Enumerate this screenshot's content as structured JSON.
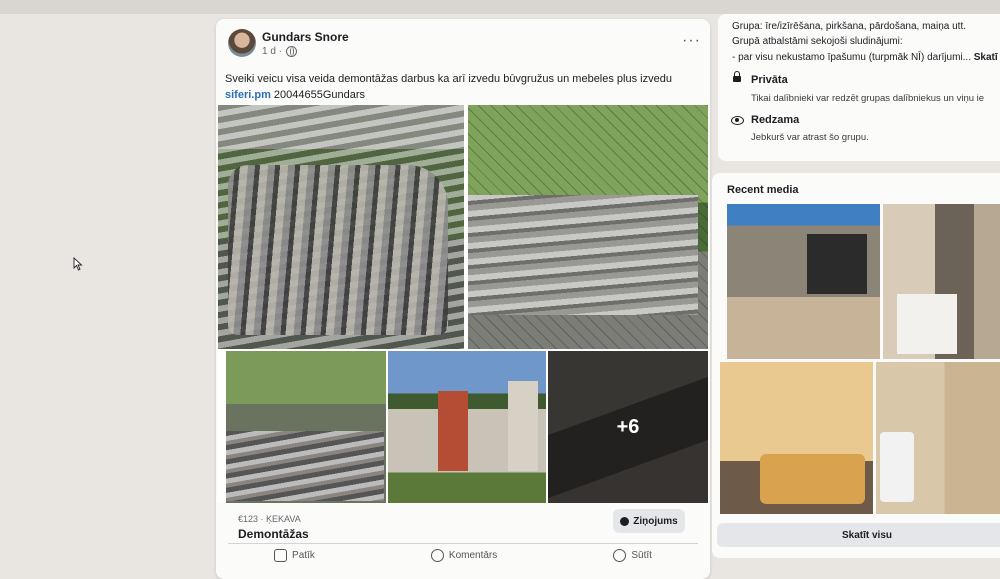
{
  "post": {
    "author": "Gundars Snore",
    "time": "1 d ·",
    "text_main": "Sveiki veicu visa veida demontāžas darbus ka arī izvedu būvgružus un mebeles plus izvedu",
    "text_link": "siferi.pm",
    "text_rest": " 20044655Gundars",
    "more_images": "+6",
    "price_location": "€123 · ĶEKAVA",
    "title": "Demontāžas",
    "message_label": "Ziņojums",
    "like_label": "Patīk",
    "comment_label": "Komentārs",
    "share_label": "Sūtīt"
  },
  "about": {
    "line1": "Grupa: īre/izīrēšana, pirkšana, pārdošana, maiņa utt.",
    "line2": "Grupā atbalstāmi sekojoši sludinājumi:",
    "line3": "- par visu nekustamo īpašumu (turpmāk NĪ) darījumi...",
    "see_more": "Skatī",
    "privacy_title": "Privāta",
    "privacy_desc": "Tikai dalībnieki var redzēt grupas dalībniekus un viņu ie",
    "visible_title": "Redzama",
    "visible_desc": "Jebkurš var atrast šo grupu."
  },
  "recent": {
    "title": "Recent media",
    "see_all": "Skatīt visu"
  }
}
